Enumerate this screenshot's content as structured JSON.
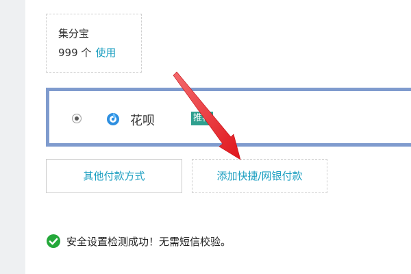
{
  "points": {
    "title": "集分宝",
    "count": "999 个",
    "use_link": "使用"
  },
  "payment_method": {
    "name": "花呗",
    "badge": "推荐",
    "selected": true,
    "icon": "huabei-logo-icon"
  },
  "buttons": {
    "other_methods": "其他付款方式",
    "add_card": "添加快捷/网银付款"
  },
  "security": {
    "icon": "check-circle-icon",
    "message": "安全设置检测成功！无需短信校验。"
  },
  "colors": {
    "link": "#1a9ec0",
    "selected_border": "#7f9bce",
    "badge_bg": "#2fa08f",
    "success": "#24a83a",
    "annotation_arrow": "#e4262b"
  }
}
